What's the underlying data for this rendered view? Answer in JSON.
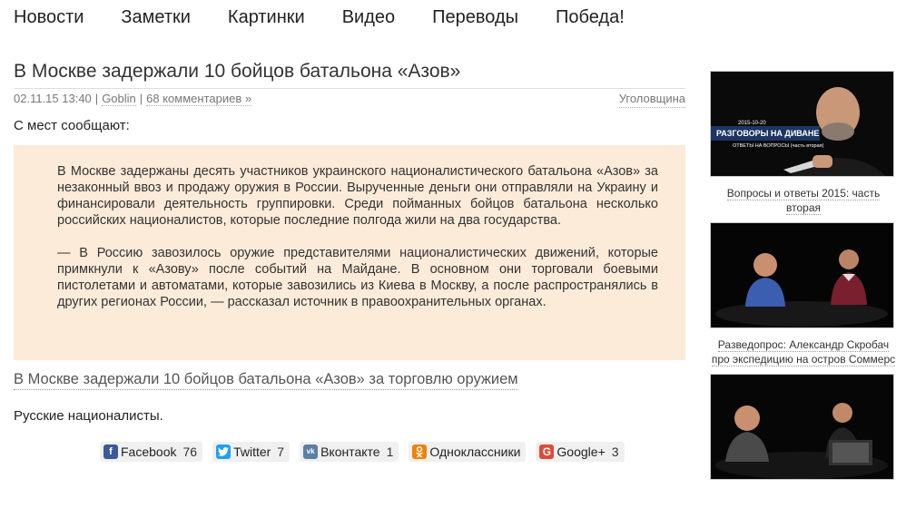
{
  "nav": [
    "Новости",
    "Заметки",
    "Картинки",
    "Видео",
    "Переводы",
    "Победа!"
  ],
  "article": {
    "title": "В Москве задержали 10 бойцов батальона «Азов»",
    "datetime": "02.11.15 13:40",
    "author": "Goblin",
    "comments": "68 комментариев »",
    "category": "Уголовщина",
    "intro": "С мест сообщают:",
    "quote_p1": "В Москве задержаны десять участников украинского националистического батальона «Азов» за незаконный ввоз и продажу оружия в России. Вырученные деньги они отправляли на Украину и финансировали деятельность группировки. Среди пойманных бойцов батальона несколько российских националистов, которые последние полгода жили на два государства.",
    "quote_p2": "— В Россию завозилось оружие представителями националистических движений, которые примкнули к «Азову» после событий на Майдане. В основном они торговали боевыми пистолетами и автоматами, которые завозились из Киева в Москву, а после распространялись в других регионах России, — рассказал источник в правоохранительных органах.",
    "source_link": "В Москве задержали 10 бойцов батальона «Азов» за торговлю оружием",
    "tags": "Русские националисты."
  },
  "share": [
    {
      "name": "Facebook",
      "count": "76",
      "color": "#3b5998",
      "glyph": "f"
    },
    {
      "name": "Twitter",
      "count": "7",
      "color": "#1da1f2",
      "glyph": "t"
    },
    {
      "name": "Вконтакте",
      "count": "1",
      "color": "#5b7fa6",
      "glyph": "vk"
    },
    {
      "name": "Одноклассники",
      "count": "",
      "color": "#ee8208",
      "glyph": "ok"
    },
    {
      "name": "Google+",
      "count": "3",
      "color": "#dd4b39",
      "glyph": "G"
    }
  ],
  "videos": [
    {
      "caption": "Вопросы и ответы 2015: часть вторая",
      "overlay_1": "2015-10-20",
      "overlay_2": "РАЗГОВОРЫ НА ДИВАНЕ",
      "overlay_3": "ОТВЕТЫ НА ВОПРОСЫ (часть вторая)"
    },
    {
      "caption": "Разведопрос: Александр Скробач про экспедицию на остров Соммерс"
    },
    {
      "caption": ""
    }
  ]
}
